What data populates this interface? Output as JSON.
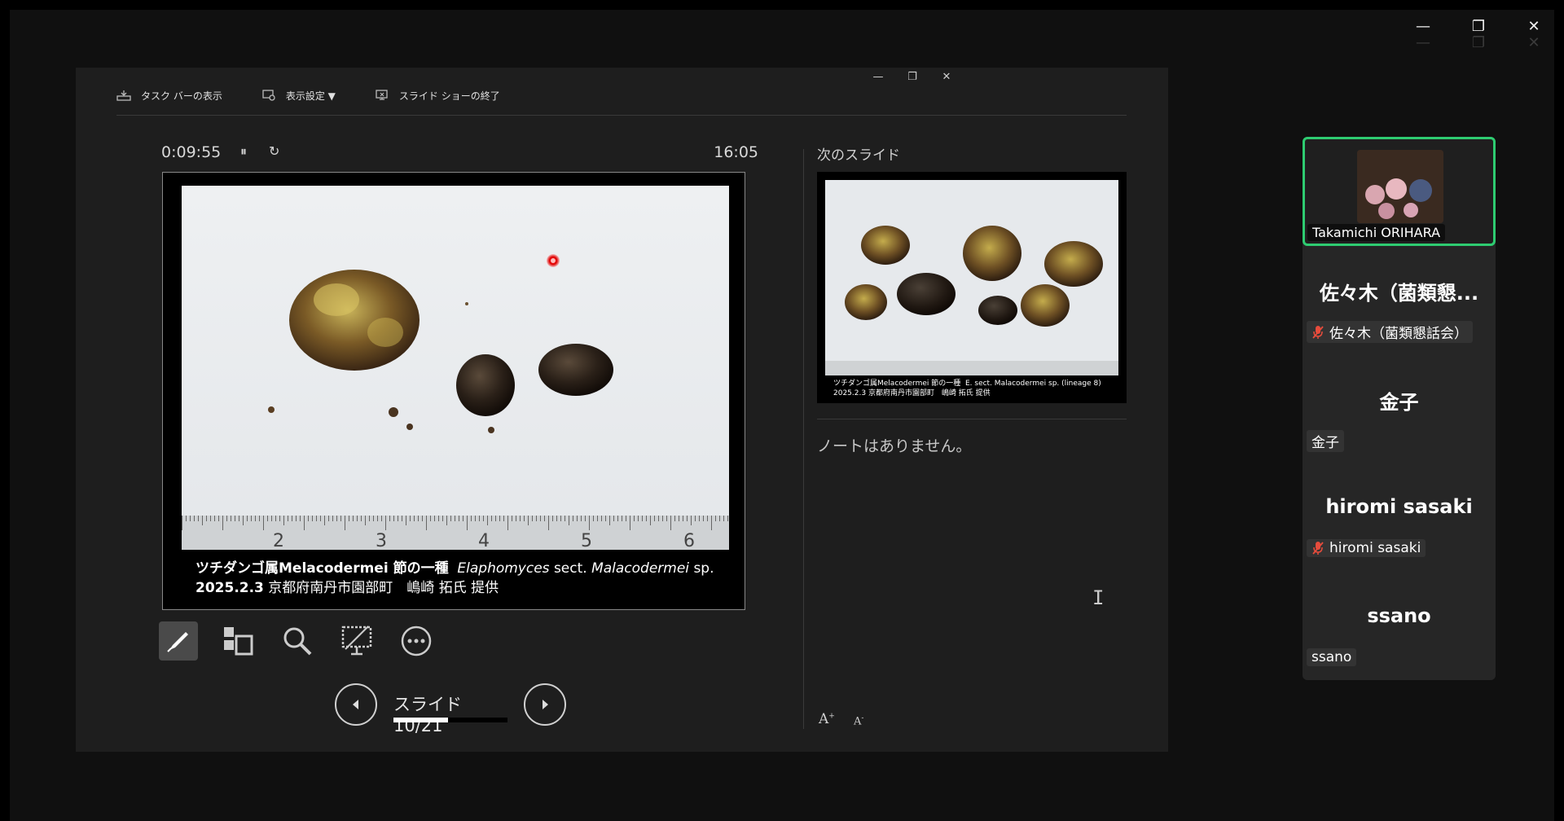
{
  "window_controls": {
    "minimize": "—",
    "restore": "❐",
    "close": "✕"
  },
  "presenter": {
    "toolbar": {
      "taskbar_label": "タスク バーの表示",
      "display_settings_label": "表示設定 ▼",
      "end_show_label": "スライド ショーの終了"
    },
    "timer": "0:09:55",
    "pause_icon": "⏸",
    "reset_icon": "↻",
    "clock": "16:05",
    "current_slide": {
      "caption_line1_jp": "ツチダンゴ属Melacodermei 節の一種",
      "caption_line1_sci_genus": "Elaphomyces",
      "caption_line1_sect": "sect.",
      "caption_line1_sci_name": "Malacodermei",
      "caption_line1_sp": "sp.",
      "caption_line2_date": "2025.2.3",
      "caption_line2_rest": "京都府南丹市園部町　嶋崎 拓氏 提供",
      "ruler_numbers": [
        "2",
        "3",
        "4",
        "5",
        "6"
      ]
    },
    "slide_counter": "スライド 10/21",
    "slide_progress": 0.476,
    "next_label": "次のスライド",
    "next_slide": {
      "caption_line1": "ツチダンゴ属Melacodermei 節の一種",
      "caption_line1_sci": "E. sect. Malacodermei sp. (lineage 8)",
      "caption_line2": "2025.2.3 京都府南丹市園部町　嶋崎 拓氏 提供"
    },
    "notes": "ノートはありません。",
    "font_increase": "A",
    "font_decrease": "A"
  },
  "participants": {
    "active": {
      "name": "Takamichi ORIHARA"
    },
    "list": [
      {
        "display": "佐々木（菌類懇...",
        "tag": "佐々木（菌類懇話会）",
        "muted": true
      },
      {
        "display": "金子",
        "tag": "金子",
        "muted": false
      },
      {
        "display": "hiromi sasaki",
        "tag": "hiromi sasaki",
        "muted": true
      },
      {
        "display": "ssano",
        "tag": "ssano",
        "muted": false
      }
    ]
  },
  "colors": {
    "active_speaker": "#2ecc71",
    "muted": "#e74c3c",
    "background": "#1e1e1e"
  }
}
